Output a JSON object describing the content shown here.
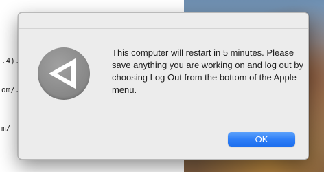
{
  "background": {
    "terminal_lines": [
      ".4).",
      "om/.",
      "m/"
    ]
  },
  "dialog": {
    "icon": "restart-alert-icon",
    "message": "This computer will restart in 5 minutes. Please save anything you are working on and log out by choosing Log Out from the bottom of the Apple menu.",
    "ok_label": "OK"
  },
  "colors": {
    "dialog_background": "#ececec",
    "button_accent": "#2e7ef7",
    "icon_gray": "#8a8a8a"
  }
}
